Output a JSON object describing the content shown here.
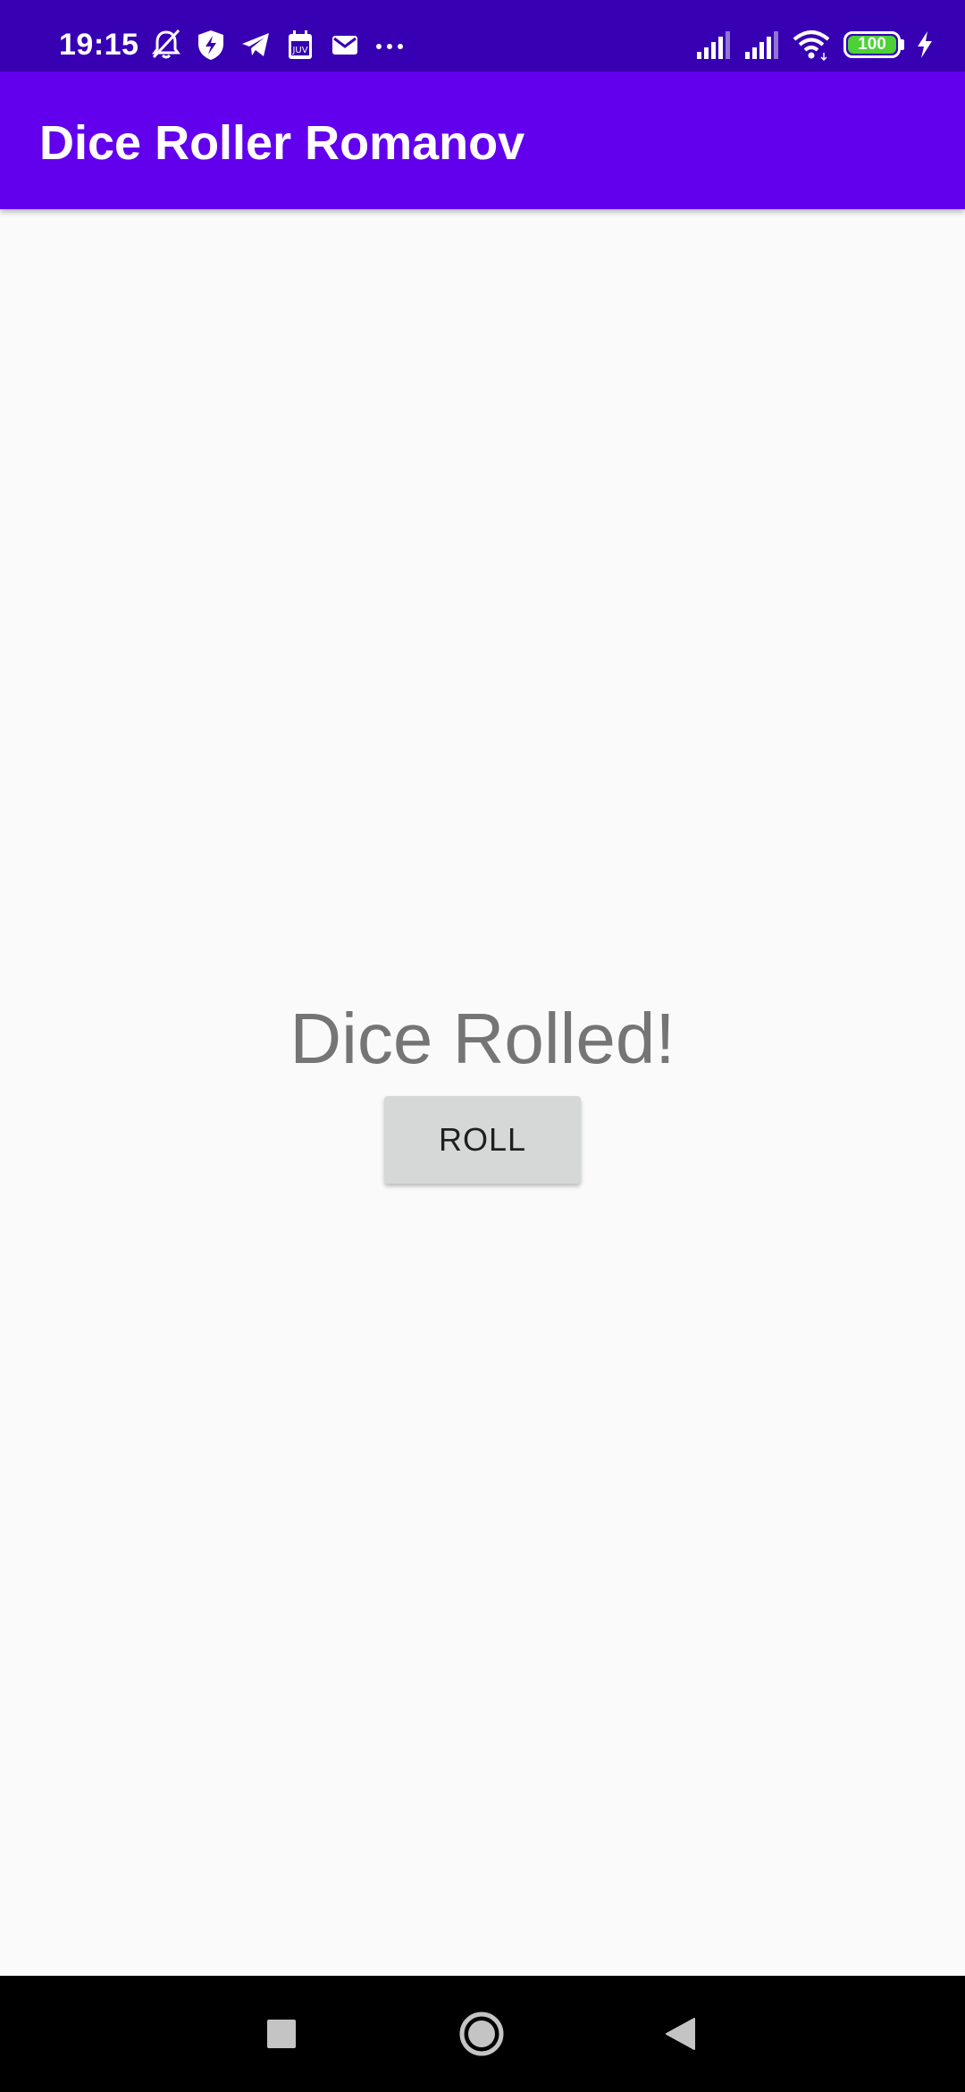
{
  "status_bar": {
    "time": "19:15",
    "battery_level": "100",
    "battery_charging": true,
    "left_icons": [
      "bell-off-icon",
      "shield-bolt-icon",
      "telegram-icon",
      "calendar-icon",
      "mail-icon",
      "more-dots-icon"
    ],
    "right_icons": [
      "signal-icon",
      "signal-icon",
      "wifi-icon",
      "battery-icon",
      "charging-bolt-icon"
    ]
  },
  "app_bar": {
    "title": "Dice Roller Romanov"
  },
  "main": {
    "result_text": "Dice Rolled!",
    "roll_button_label": "ROLL"
  },
  "nav_bar": {
    "buttons": [
      "recents",
      "home",
      "back"
    ]
  },
  "colors": {
    "status_bar": "#3700b3",
    "app_bar": "#6200ee",
    "background": "#fafafa",
    "result_text": "#757575",
    "button_bg": "#d6d7d7",
    "battery_fill": "#4cd137",
    "nav_bar": "#000000"
  }
}
